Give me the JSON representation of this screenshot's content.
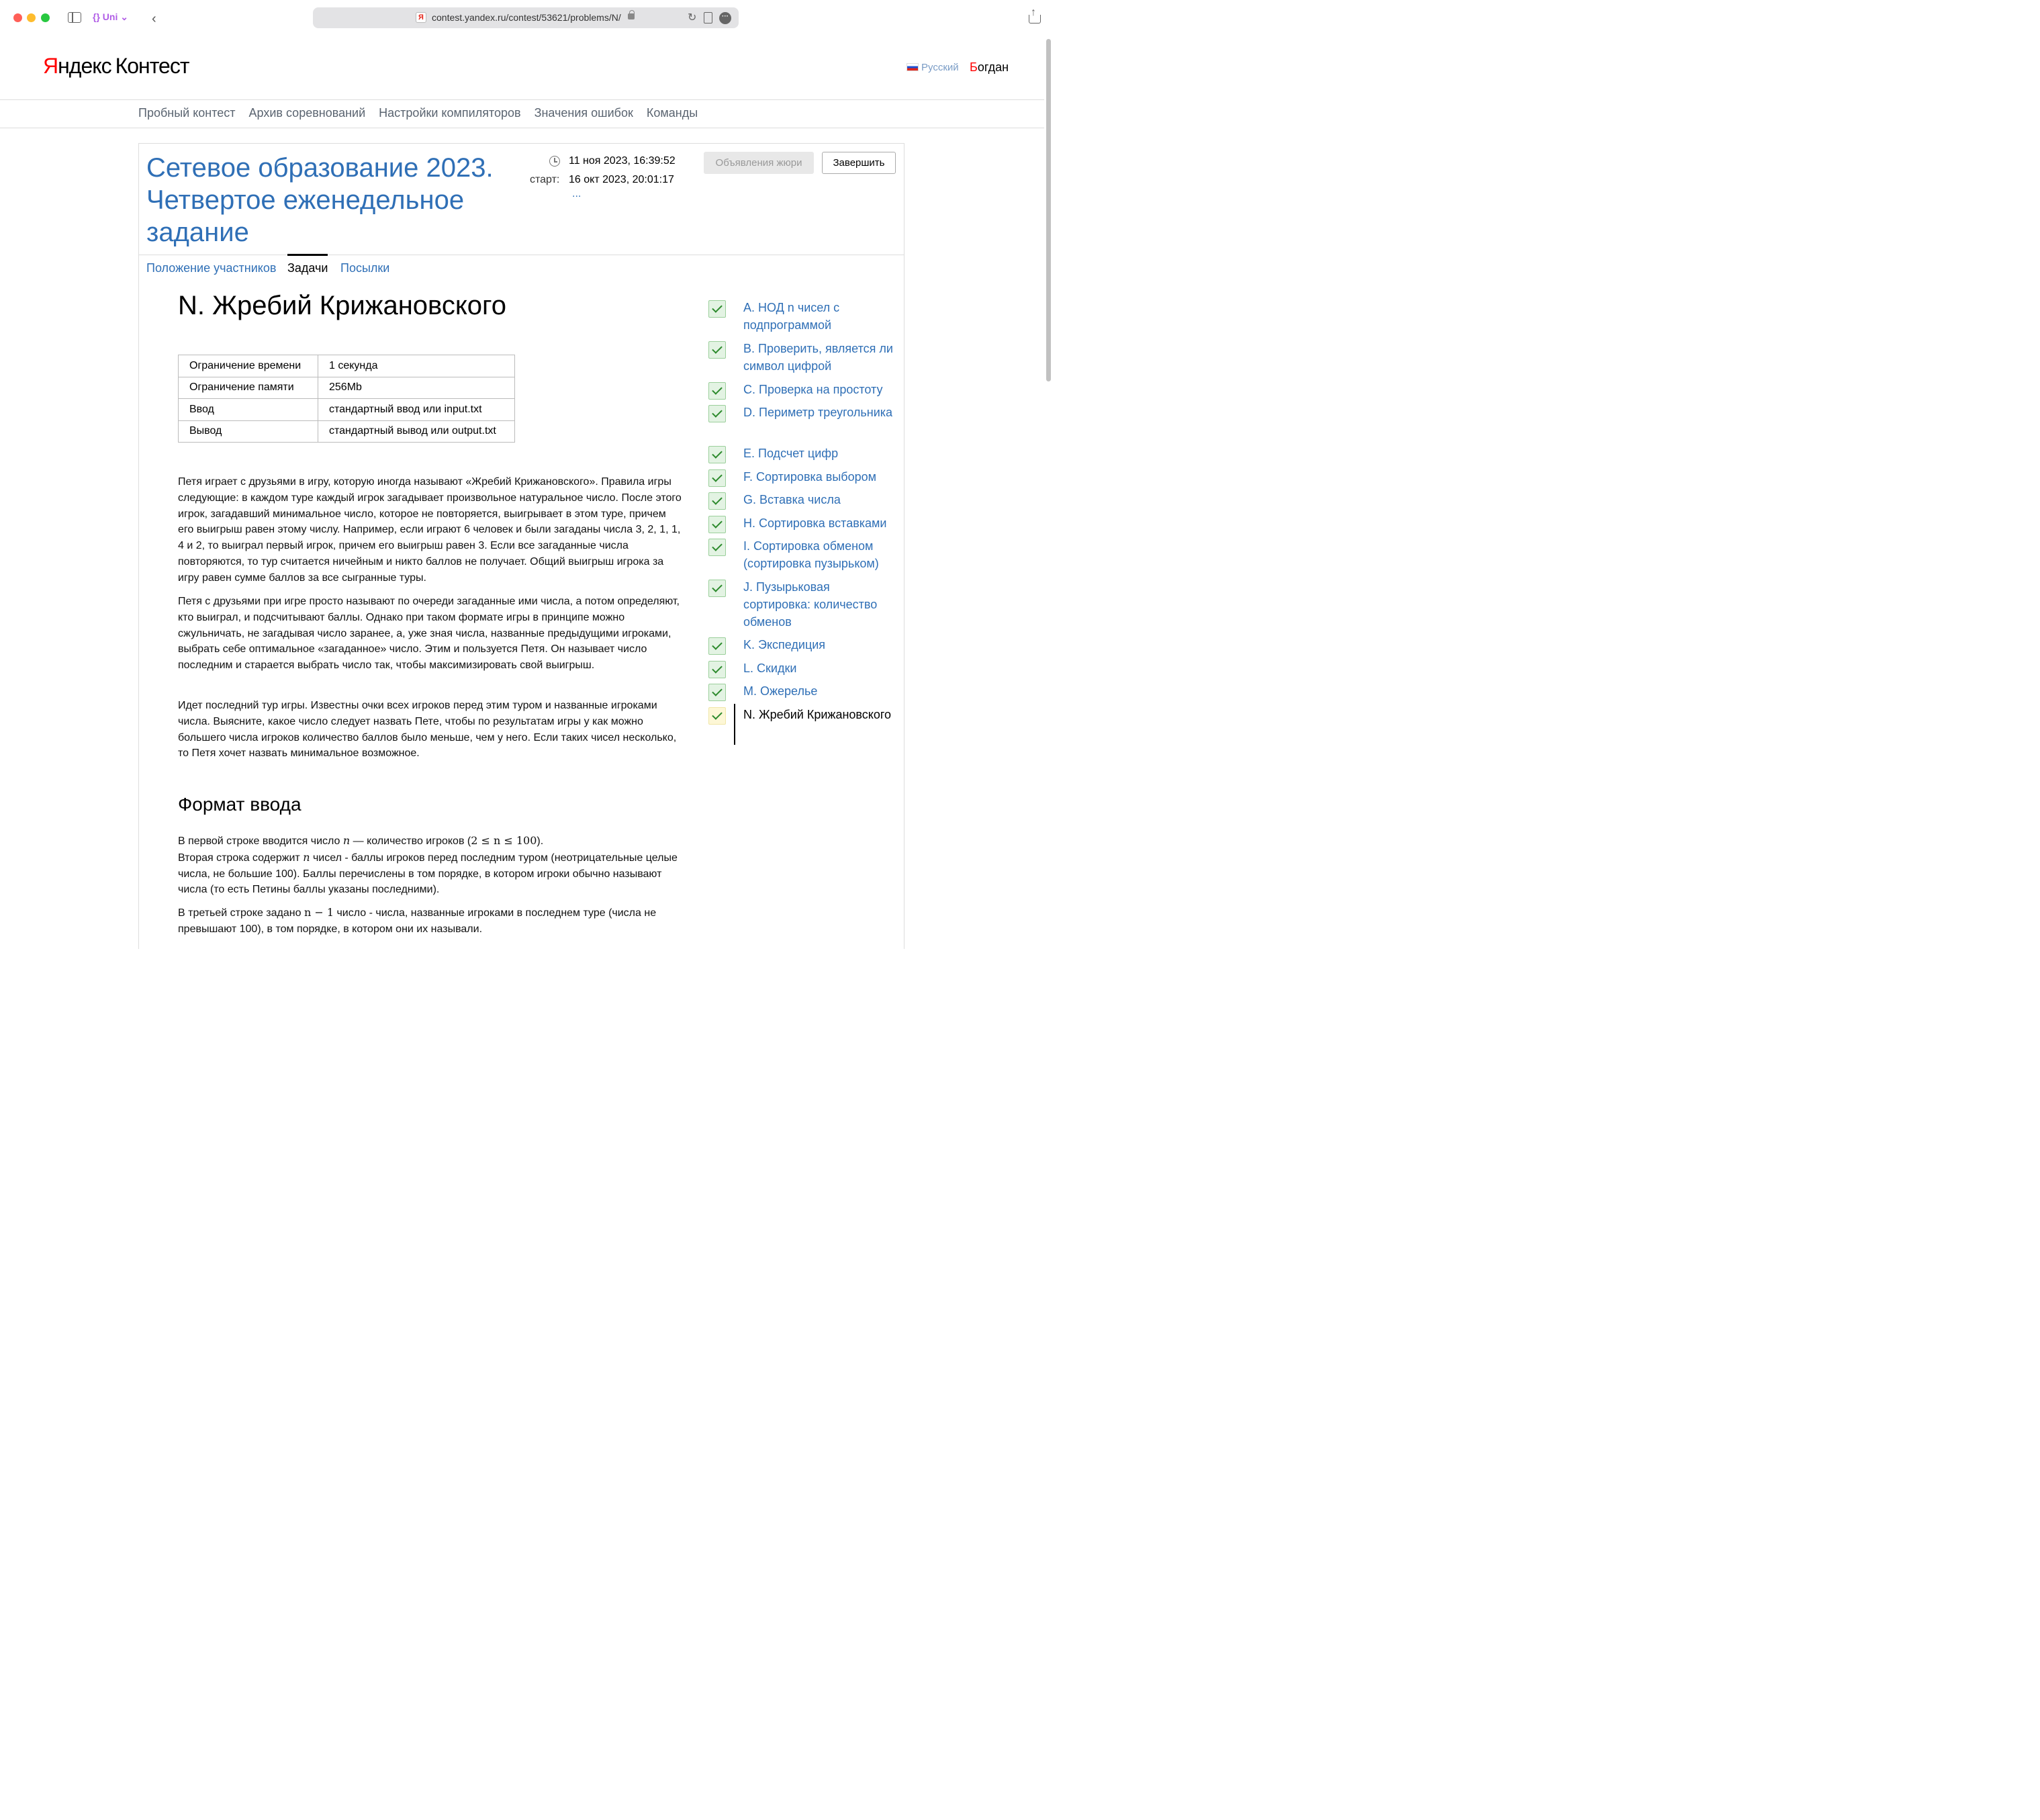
{
  "browser": {
    "tab_group": "{} Uni ⌄",
    "url": "contest.yandex.ru/contest/53621/problems/N/",
    "favicon": "Я"
  },
  "header": {
    "logo_ya": "Я",
    "logo_ndex": "ндекс",
    "logo_kontest": "Контест",
    "language": "Русский",
    "user_first_letter": "Б",
    "user_rest": "огдан"
  },
  "topnav": [
    "Пробный контест",
    "Архив соревнований",
    "Настройки компиляторов",
    "Значения ошибок",
    "Команды"
  ],
  "contest": {
    "title": "Сетевое образование 2023. Четвертое еженедельное задание",
    "current_time": "11 ноя 2023, 16:39:52",
    "start_label": "старт:",
    "start_time": "16 окт 2023, 20:01:17",
    "more": "...",
    "announcements_button": "Объявления жюри",
    "finish_button": "Завершить"
  },
  "tabs": {
    "standings": "Положение участников",
    "problems": "Задачи",
    "submissions": "Посылки"
  },
  "problem": {
    "title": "N. Жребий Крижановского",
    "limits": [
      {
        "key": "Ограничение времени",
        "value": "1 секунда"
      },
      {
        "key": "Ограничение памяти",
        "value": "256Mb"
      },
      {
        "key": "Ввод",
        "value": "стандартный ввод или input.txt"
      },
      {
        "key": "Вывод",
        "value": "стандартный вывод или output.txt"
      }
    ],
    "paragraphs": [
      "Петя играет с друзьями в игру, которую иногда называют «Жребий Крижановского». Правила игры следующие: в каждом туре каждый игрок загадывает произвольное натуральное число. После этого игрок, загадавший минимальное число, которое не повторяется, выигрывает в этом туре, причем его выигрыш равен этому числу. Например, если играют 6 человек и были загаданы числа 3, 2, 1, 1, 4 и 2, то выиграл первый игрок, причем его выигрыш равен 3. Если все загаданные числа повторяются, то тур считается ничейным и никто баллов не получает. Общий выигрыш игрока за игру равен сумме баллов за все сыгранные туры.",
      "Петя с друзьями при игре просто называют по очереди загаданные ими числа, а потом определяют, кто выиграл, и подсчитывают баллы. Однако при таком формате игры в принципе можно сжульничать, не загадывая число заранее, а, уже зная числа, названные предыдущими игроками, выбрать себе оптимальное «загаданное» число. Этим и пользуется Петя. Он называет число последним и старается выбрать число так, чтобы максимизировать свой выигрыш.",
      "Идет последний тур игры. Известны очки всех игроков перед этим туром и названные игроками числа. Выясните, какое число следует назвать Пете, чтобы по результатам игры у как можно большего числа игроков количество баллов было меньше, чем у него. Если таких чисел несколько, то Петя хочет назвать минимальное возможное."
    ],
    "input_heading": "Формат ввода",
    "input_line1_a": "В первой строке вводится число ",
    "input_line1_var": "n",
    "input_line1_b": " — количество игроков (",
    "input_line1_math": "2 ≤ n ≤ 100",
    "input_line1_c": ").",
    "input_line2_a": "Вторая строка содержит ",
    "input_line2_var": "n",
    "input_line2_b": " чисел - баллы игроков перед последним туром (неотрицательные целые числа, не большие 100). Баллы перечислены в том порядке, в котором игроки обычно называют числа (то есть Петины баллы указаны последними).",
    "input_line3_a": "В третьей строке задано ",
    "input_line3_math": "n − 1",
    "input_line3_b": " число - числа, названные игроками в последнем туре (числа не превышают 100), в том порядке, в котором они их называли."
  },
  "problem_list": [
    {
      "label": "A. НОД n чисел с подпрограммой",
      "state": "ok"
    },
    {
      "label": "B. Проверить, является ли символ цифрой",
      "state": "ok"
    },
    {
      "label": "C. Проверка на простоту",
      "state": "ok"
    },
    {
      "label": "D. Периметр треугольника",
      "state": "ok"
    },
    {
      "label": "E. Подсчет цифр",
      "state": "ok"
    },
    {
      "label": "F. Сортировка выбором",
      "state": "ok"
    },
    {
      "label": "G. Вставка числа",
      "state": "ok"
    },
    {
      "label": "H. Сортировка вставками",
      "state": "ok"
    },
    {
      "label": "I. Сортировка обменом (сортировка пузырьком)",
      "state": "ok"
    },
    {
      "label": "J. Пузырьковая сортировка: количество обменов",
      "state": "ok"
    },
    {
      "label": "K. Экспедиция",
      "state": "ok"
    },
    {
      "label": "L. Скидки",
      "state": "ok"
    },
    {
      "label": "M. Ожерелье",
      "state": "ok"
    },
    {
      "label": "N. Жребий Крижановского",
      "state": "current"
    }
  ],
  "colors": {
    "link": "#2f6fb6",
    "accepted_bg": "#e3f3e3",
    "current_bg": "#fdf7d6"
  }
}
